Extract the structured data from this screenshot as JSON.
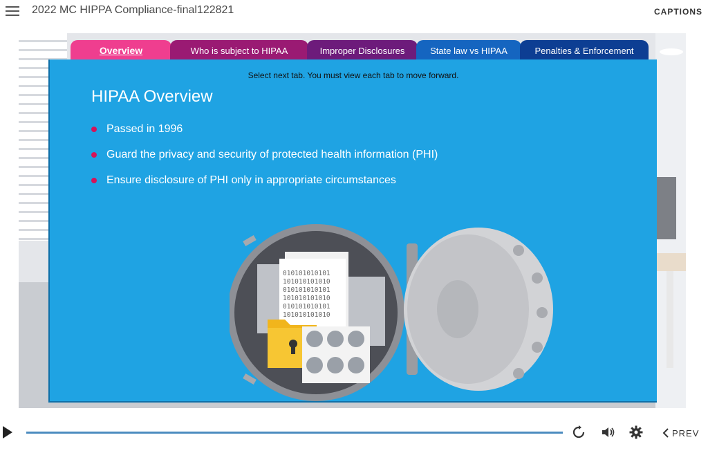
{
  "header": {
    "course_title": "2022 MC HIPPA Compliance-final122821",
    "captions_label": "CAPTIONS"
  },
  "tabs": [
    {
      "label": "Overview",
      "color": "#ef3e8f",
      "active": true
    },
    {
      "label": "Who is subject to HIPAA",
      "color": "#9a1a73",
      "active": false
    },
    {
      "label": "Improper Disclosures",
      "color": "#6d1b7b",
      "active": false
    },
    {
      "label": "State law vs HIPAA",
      "color": "#1565c0",
      "active": false
    },
    {
      "label": "Penalties & Enforcement",
      "color": "#0d3e93",
      "active": false
    }
  ],
  "slide": {
    "instruction": "Select next tab. You must view each tab to move forward.",
    "heading": "HIPAA Overview",
    "bullets": [
      "Passed in 1996",
      "Guard the privacy and security of protected health information (PHI)",
      "Ensure disclosure of PHI only in appropriate circumstances"
    ],
    "binary_lines": [
      "010101010101",
      "101010101010",
      "010101010101",
      "101010101010",
      "010101010101",
      "101010101010"
    ],
    "panel_color": "#1fa3e3",
    "bullet_color": "#d4145a"
  },
  "controls": {
    "prev_label": "PREV",
    "icons": [
      "play-icon",
      "replay-icon",
      "volume-icon",
      "settings-icon",
      "chevron-left-icon"
    ]
  }
}
